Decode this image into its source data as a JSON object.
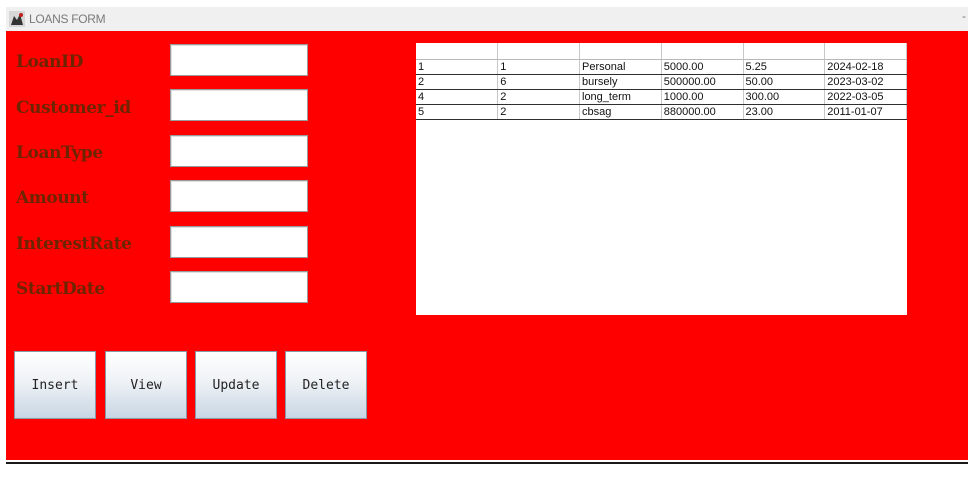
{
  "window": {
    "title": "LOANS FORM",
    "right_text": "-"
  },
  "form": {
    "fields": [
      {
        "label": "LoanID",
        "value": ""
      },
      {
        "label": "Customer_id",
        "value": ""
      },
      {
        "label": "LoanType",
        "value": ""
      },
      {
        "label": "Amount",
        "value": ""
      },
      {
        "label": "InterestRate",
        "value": ""
      },
      {
        "label": "StartDate",
        "value": ""
      }
    ]
  },
  "buttons": {
    "insert": "Insert",
    "view": "View",
    "update": "Update",
    "delete": "Delete"
  },
  "table": {
    "headers": [
      "",
      "",
      "",
      "",
      "",
      ""
    ],
    "rows": [
      [
        "1",
        "1",
        "Personal",
        "5000.00",
        "5.25",
        "2024-02-18"
      ],
      [
        "2",
        "6",
        "bursely",
        "500000.00",
        "50.00",
        "2023-03-02"
      ],
      [
        "4",
        "2",
        "long_term",
        "1000.00",
        "300.00",
        "2022-03-05"
      ],
      [
        "5",
        "2",
        "cbsag",
        "880000.00",
        "23.00",
        "2011-01-07"
      ]
    ]
  },
  "colors": {
    "panel_background": "#ff0000",
    "label_text": "#6d2400"
  }
}
